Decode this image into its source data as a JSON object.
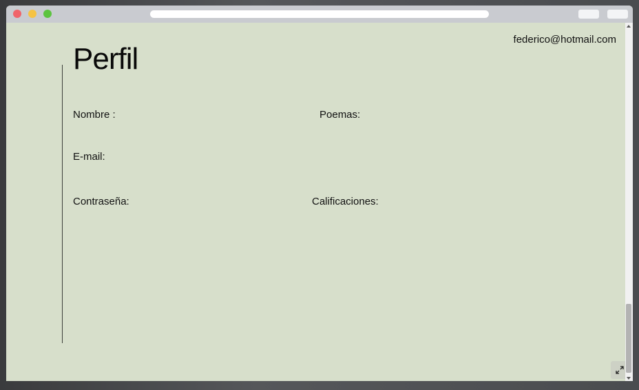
{
  "header": {
    "user_email": "federico@hotmail.com"
  },
  "profile": {
    "title": "Perfil",
    "fields": {
      "nombre_label": "Nombre :",
      "email_label": "E-mail:",
      "password_label": "Contraseña:",
      "poemas_label": "Poemas:",
      "calificaciones_label": "Calificaciones:"
    }
  },
  "colors": {
    "background": "#d7dfcb",
    "text": "#111111",
    "titlebar": "#c9cbd0"
  },
  "icons": {
    "expand": "expand-icon"
  }
}
